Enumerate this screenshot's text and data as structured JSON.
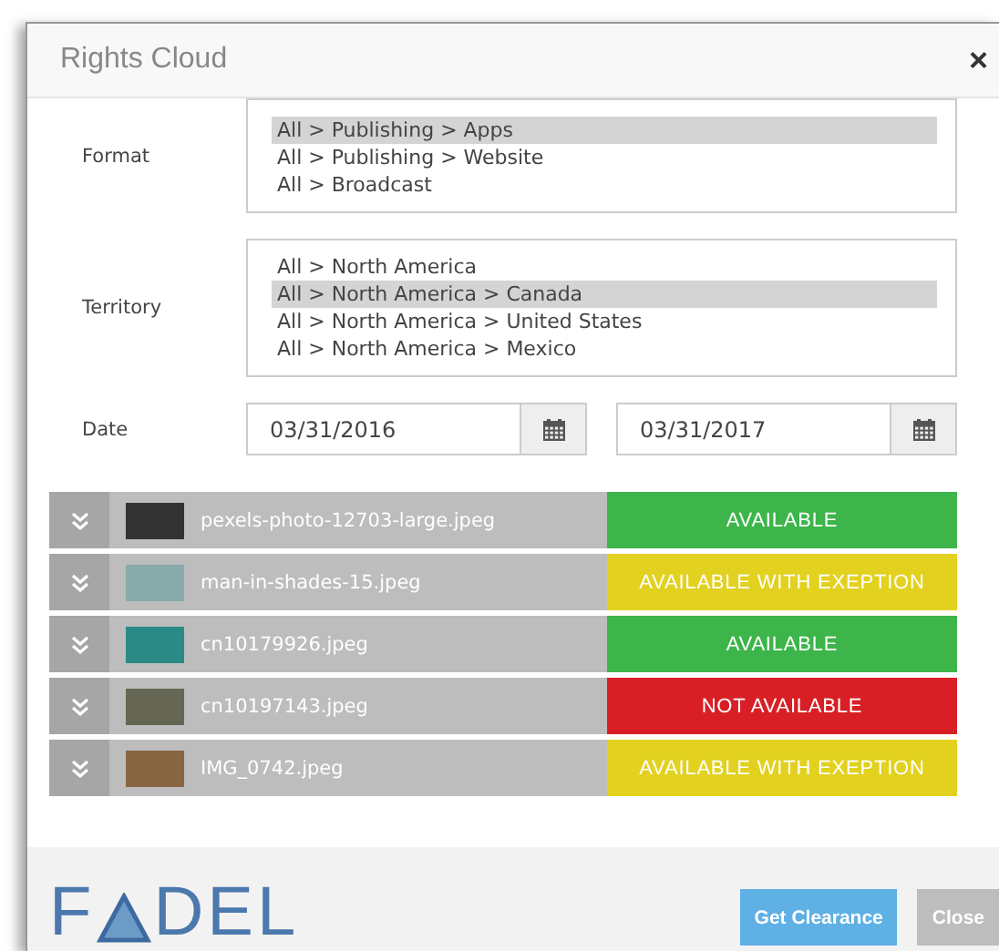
{
  "dialog": {
    "title": "Rights Cloud",
    "close": "×"
  },
  "format": {
    "label": "Format",
    "options": [
      {
        "text": "All > Publishing > Apps",
        "selected": true
      },
      {
        "text": "All > Publishing > Website",
        "selected": false
      },
      {
        "text": "All > Broadcast",
        "selected": false
      }
    ]
  },
  "territory": {
    "label": "Territory",
    "options": [
      {
        "text": "All > North America",
        "selected": false
      },
      {
        "text": "All > North America > Canada",
        "selected": true
      },
      {
        "text": "All > North America > United States",
        "selected": false
      },
      {
        "text": "All > North America > Mexico",
        "selected": false
      }
    ]
  },
  "date": {
    "label": "Date",
    "from": "03/31/2016",
    "to": "03/31/2017"
  },
  "assets": [
    {
      "name": "pexels-photo-12703-large.jpeg",
      "status": "AVAILABLE",
      "color": "#3db54a"
    },
    {
      "name": "man-in-shades-15.jpeg",
      "status": "AVAILABLE WITH EXEPTION",
      "color": "#e2d11f"
    },
    {
      "name": "cn10179926.jpeg",
      "status": "AVAILABLE",
      "color": "#3db54a"
    },
    {
      "name": "cn10197143.jpeg",
      "status": "NOT AVAILABLE",
      "color": "#d81f26"
    },
    {
      "name": "IMG_0742.jpeg",
      "status": "AVAILABLE WITH EXEPTION",
      "color": "#e2d11f"
    }
  ],
  "footer": {
    "logo_left": "F",
    "logo_right": "DEL",
    "buttons": [
      {
        "label": "Get Clearance",
        "kind": "primary"
      },
      {
        "label": "Close",
        "kind": "secondary"
      }
    ]
  }
}
